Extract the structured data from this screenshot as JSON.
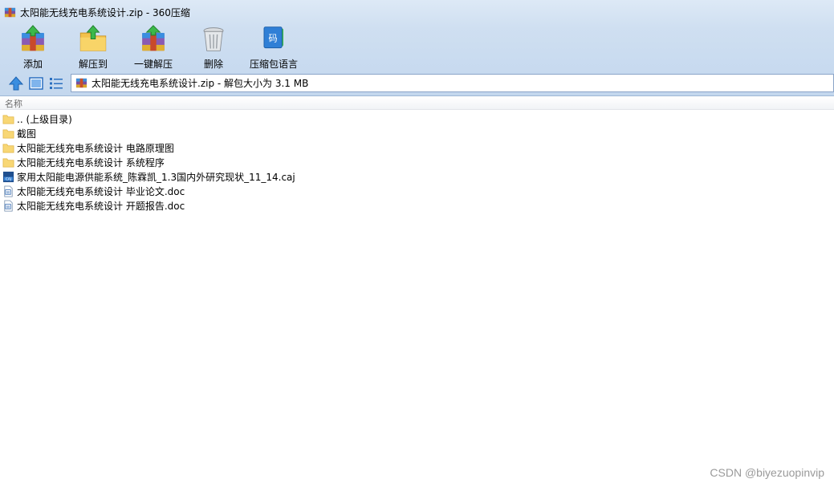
{
  "window": {
    "title": "太阳能无线充电系统设计.zip - 360压缩"
  },
  "toolbar": {
    "buttons": [
      {
        "label": "添加",
        "icon": "add-archive-icon"
      },
      {
        "label": "解压到",
        "icon": "extract-to-icon"
      },
      {
        "label": "一键解压",
        "icon": "one-click-extract-icon"
      },
      {
        "label": "删除",
        "icon": "delete-trash-icon"
      },
      {
        "label": "压缩包语言",
        "icon": "archive-language-icon"
      }
    ]
  },
  "nav": {
    "icons": [
      "up-arrow-icon",
      "thumbnail-view-icon",
      "list-view-icon"
    ]
  },
  "address": {
    "text": "太阳能无线充电系统设计.zip - 解包大小为 3.1 MB"
  },
  "list": {
    "column_name": "名称",
    "items": [
      {
        "name": ".. (上级目录)",
        "type": "folder"
      },
      {
        "name": "截图",
        "type": "folder"
      },
      {
        "name": "太阳能无线充电系统设计 电路原理图",
        "type": "folder"
      },
      {
        "name": "太阳能无线充电系统设计 系统程序",
        "type": "folder"
      },
      {
        "name": "家用太阳能电源供能系统_陈霖凯_1.3国内外研究现状_11_14.caj",
        "type": "caj"
      },
      {
        "name": "太阳能无线充电系统设计 毕业论文.doc",
        "type": "doc"
      },
      {
        "name": "太阳能无线充电系统设计 开题报告.doc",
        "type": "doc"
      }
    ]
  },
  "watermark": "CSDN @biyezuopinvip"
}
